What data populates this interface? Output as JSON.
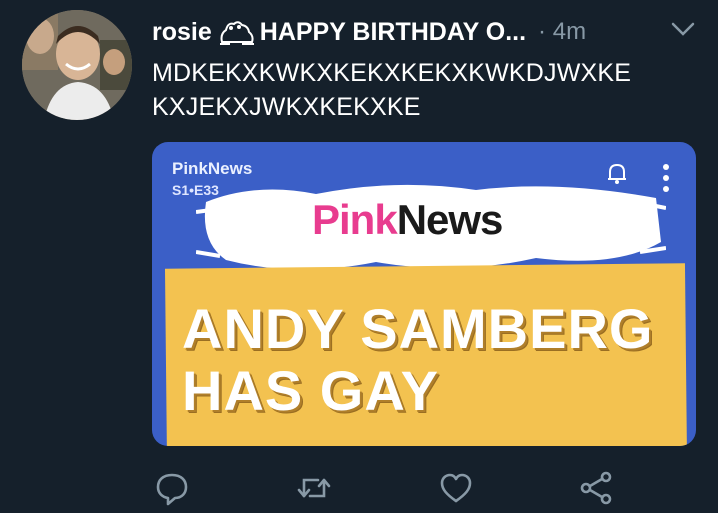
{
  "tweet": {
    "username": "rosie",
    "display_rest": "HAPPY BIRTHDAY O...",
    "separator": " · ",
    "time": "4m",
    "text": "MDKEKXKWKXKEKXKEKXKWKDJWXKE\nKXJEKXJWKXKEKXKE"
  },
  "card": {
    "source": "PinkNews",
    "episode": "S1•E33",
    "logo_pink": "Pink",
    "logo_news": "News",
    "headline": "ANDY SAMBERG\nHAS GAY",
    "colors": {
      "background": "#3b5fc7",
      "banner": "#f3c250",
      "logo_pink": "#e83c8f"
    }
  },
  "actions": {
    "icons": [
      "reply-icon",
      "retweet-icon",
      "like-icon",
      "share-icon"
    ]
  },
  "colors": {
    "background": "#15202b",
    "secondary_text": "#8899a6"
  }
}
